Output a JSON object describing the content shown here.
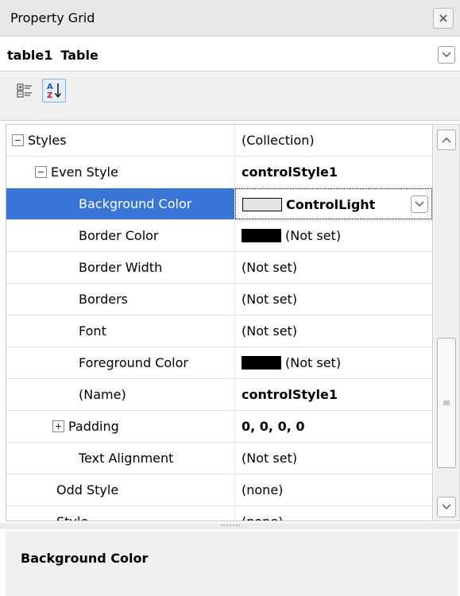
{
  "panel": {
    "title": "Property Grid"
  },
  "object_selector": {
    "name": "table1",
    "type": "Table"
  },
  "toolbar": {
    "categorized_icon": "categorized-icon",
    "alphabetical_icon": "sort-az-icon"
  },
  "rows": [
    {
      "name": "Styles",
      "value": "(Collection)",
      "expander": "minus"
    },
    {
      "name": "Even Style",
      "value": "controlStyle1",
      "expander": "minus"
    },
    {
      "name": "Background Color",
      "value": "ControlLight",
      "swatch": "light"
    },
    {
      "name": "Border Color",
      "value": "(Not set)",
      "swatch": "dark"
    },
    {
      "name": "Border Width",
      "value": "(Not set)"
    },
    {
      "name": "Borders",
      "value": "(Not set)"
    },
    {
      "name": "Font",
      "value": "(Not set)"
    },
    {
      "name": "Foreground Color",
      "value": "(Not set)",
      "swatch": "dark"
    },
    {
      "name": "(Name)",
      "value": "controlStyle1"
    },
    {
      "name": "Padding",
      "value": "0, 0, 0, 0",
      "expander": "plus"
    },
    {
      "name": "Text Alignment",
      "value": "(Not set)"
    },
    {
      "name": "Odd Style",
      "value": "(none)"
    },
    {
      "name": "Style",
      "value": "(none)"
    }
  ],
  "description": {
    "title": "Background Color"
  },
  "colors": {
    "selection": "#3875d7",
    "swatch_light": "#e3e3e3",
    "swatch_dark": "#000000"
  }
}
